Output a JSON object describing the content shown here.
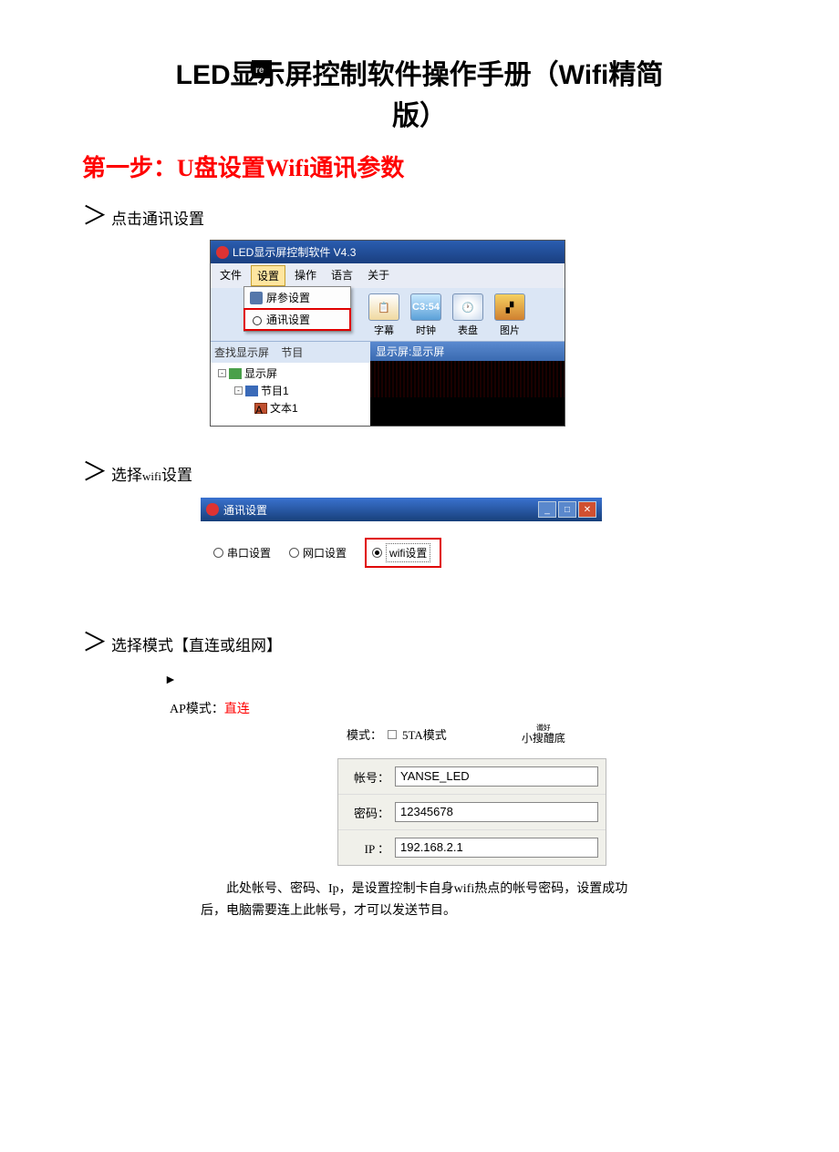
{
  "title": {
    "line1": "LED显示屏控制软件操作手册（Wifi精简",
    "line2": "版）",
    "watermark": "re"
  },
  "step_heading": "第一步：U盘设置Wifi通讯参数",
  "bullets": {
    "b1": "点击通讯设置",
    "b2a": "选择",
    "b2b": "wifi",
    "b2c": "设置",
    "b3": "选择模式【直连或组网】"
  },
  "shot1": {
    "title": "LED显示屏控制软件  V4.3",
    "menu": {
      "file": "文件",
      "settings": "设置",
      "ops": "操作",
      "lang": "语言",
      "about": "关于"
    },
    "dropdown": {
      "item1": "屏参设置",
      "item2": "通讯设置"
    },
    "toolbar": {
      "sub": "字幕",
      "clock": "时钟",
      "dial": "表盘",
      "pic": "图片",
      "clock_txt": "C3:54"
    },
    "find": "查找显示屏",
    "find2": "节目",
    "tree": {
      "root": "显示屏",
      "prog": "节目1",
      "text": "文本1"
    },
    "preview_label": "显示屏:显示屏"
  },
  "shot2": {
    "title": "通讯设置",
    "opt1": "串口设置",
    "opt2": "网口设置",
    "opt3": "wifi设置"
  },
  "ap": {
    "arrow": "►",
    "label": "AP模式：",
    "value": "直连",
    "mode_label": "模式：",
    "mode_opt": "5TA模式",
    "mode_right": "小搜醴底",
    "ruby": "谶好"
  },
  "form": {
    "l1": "帐号：",
    "v1": "YANSE_LED",
    "l2": "密码：",
    "v2": "12345678",
    "l3": "IP ：",
    "v3": "192.168.2.1"
  },
  "para": "此处帐号、密码、Ip，是设置控制卡自身wifi热点的帐号密码，设置成功后，电脑需要连上此帐号，才可以发送节目。"
}
